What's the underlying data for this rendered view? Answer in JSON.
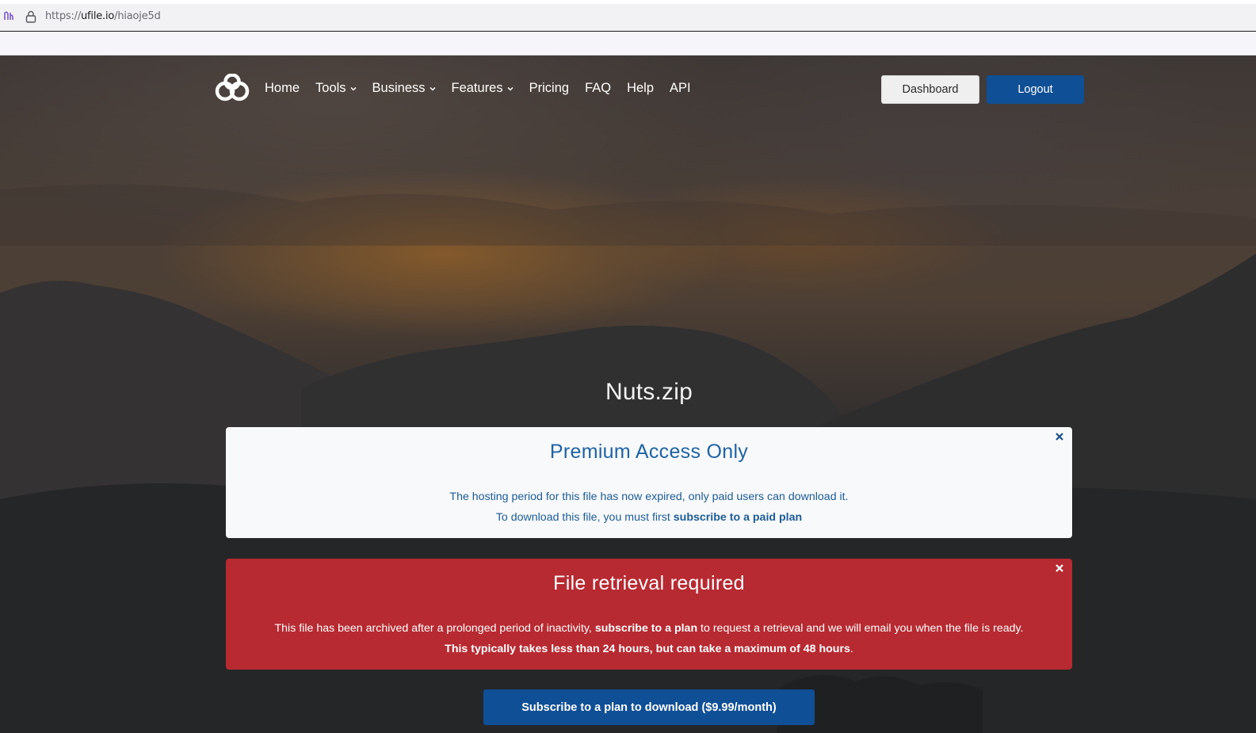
{
  "browser": {
    "url_scheme": "https://",
    "url_host": "ufile.io",
    "url_path": "/hiaoje5d",
    "icons": {
      "extension": "extension-icon",
      "lock": "lock-icon"
    }
  },
  "site": {
    "logo": "ufile-logo",
    "nav": [
      {
        "label": "Home",
        "dropdown": false
      },
      {
        "label": "Tools",
        "dropdown": true
      },
      {
        "label": "Business",
        "dropdown": true
      },
      {
        "label": "Features",
        "dropdown": true
      },
      {
        "label": "Pricing",
        "dropdown": false
      },
      {
        "label": "FAQ",
        "dropdown": false
      },
      {
        "label": "Help",
        "dropdown": false
      },
      {
        "label": "API",
        "dropdown": false
      }
    ],
    "dashboard_label": "Dashboard",
    "logout_label": "Logout",
    "colors": {
      "primary": "#0f4f95",
      "alert_red": "#b72a31",
      "info_text": "#1b5c97"
    }
  },
  "file": {
    "name": "Nuts.zip"
  },
  "premium_card": {
    "heading": "Premium Access Only",
    "line1": "The hosting period for this file has now expired, only paid users can download it.",
    "line2_prefix": "To download this file, you must first ",
    "line2_link": "subscribe to a paid plan",
    "close_icon": "close-icon"
  },
  "retrieval_card": {
    "heading": "File retrieval required",
    "line1_prefix": "This file has been archived after a prolonged period of inactivity, ",
    "line1_link": "subscribe to a plan",
    "line1_suffix": " to request a retrieval and we will email you when the file is ready.",
    "line2_bold": "This typically takes less than 24 hours, but can take a maximum of 48 hours",
    "line2_suffix": ".",
    "close_icon": "close-icon"
  },
  "subscribe_button": {
    "label": "Subscribe to a plan to download ($9.99/month)"
  }
}
